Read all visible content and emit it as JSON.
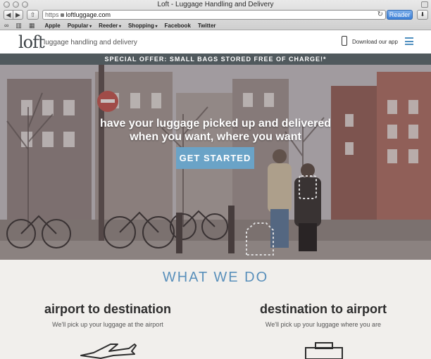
{
  "browser": {
    "window_title": "Loft - Luggage Handling and Delivery",
    "url_scheme": "https",
    "url_host": "loftluggage.com",
    "reader_label": "Reader",
    "bookmarks": [
      "Apple",
      "Popular",
      "Reeder",
      "Shopping",
      "Facebook",
      "Twitter"
    ]
  },
  "site": {
    "logo": "loft",
    "tagline": "luggage handling and delivery",
    "download_label": "Download our app",
    "offer": "SPECIAL OFFER: SMALL BAGS STORED FREE OF CHARGE!*"
  },
  "hero": {
    "line1": "have your luggage picked up and delivered",
    "line2": "when you want, where you want",
    "cta": "GET STARTED"
  },
  "what_we_do": {
    "title": "WHAT WE DO",
    "left": {
      "heading": "airport to destination",
      "text": "We'll pick up your luggage at the airport"
    },
    "right": {
      "heading": "destination to airport",
      "text": "We'll pick up your luggage where you are"
    }
  },
  "colors": {
    "accent": "#6aa3c7",
    "offer_bar": "#50595d",
    "reader": "#3b7fd6"
  },
  "icons": [
    "back-arrow-icon",
    "forward-arrow-icon",
    "share-icon",
    "lock-icon",
    "reload-icon",
    "download-icon",
    "phone-icon",
    "menu-icon",
    "airplane-icon",
    "suitcase-icon"
  ]
}
